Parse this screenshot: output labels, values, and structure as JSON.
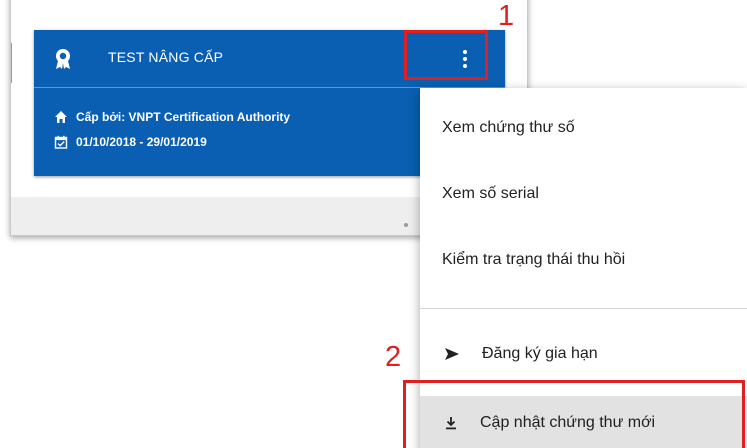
{
  "certificate": {
    "title": "TEST NÂNG CẤP",
    "issuer": "Cấp bởi: VNPT Certification Authority",
    "validity": "01/10/2018 - 29/01/2019",
    "card_color": "#0a5fb2"
  },
  "menu": {
    "items": [
      {
        "label": "Xem chứng thư số",
        "icon": ""
      },
      {
        "label": "Xem số serial",
        "icon": ""
      },
      {
        "label": "Kiểm tra trạng thái thu hồi",
        "icon": ""
      },
      {
        "label": "Đăng ký gia hạn",
        "icon": "send-icon"
      },
      {
        "label": "Cập nhật chứng thư mới",
        "icon": "download-icon",
        "highlighted": true
      }
    ]
  },
  "annotations": {
    "step1": "1",
    "step2": "2",
    "color": "#e02020"
  }
}
